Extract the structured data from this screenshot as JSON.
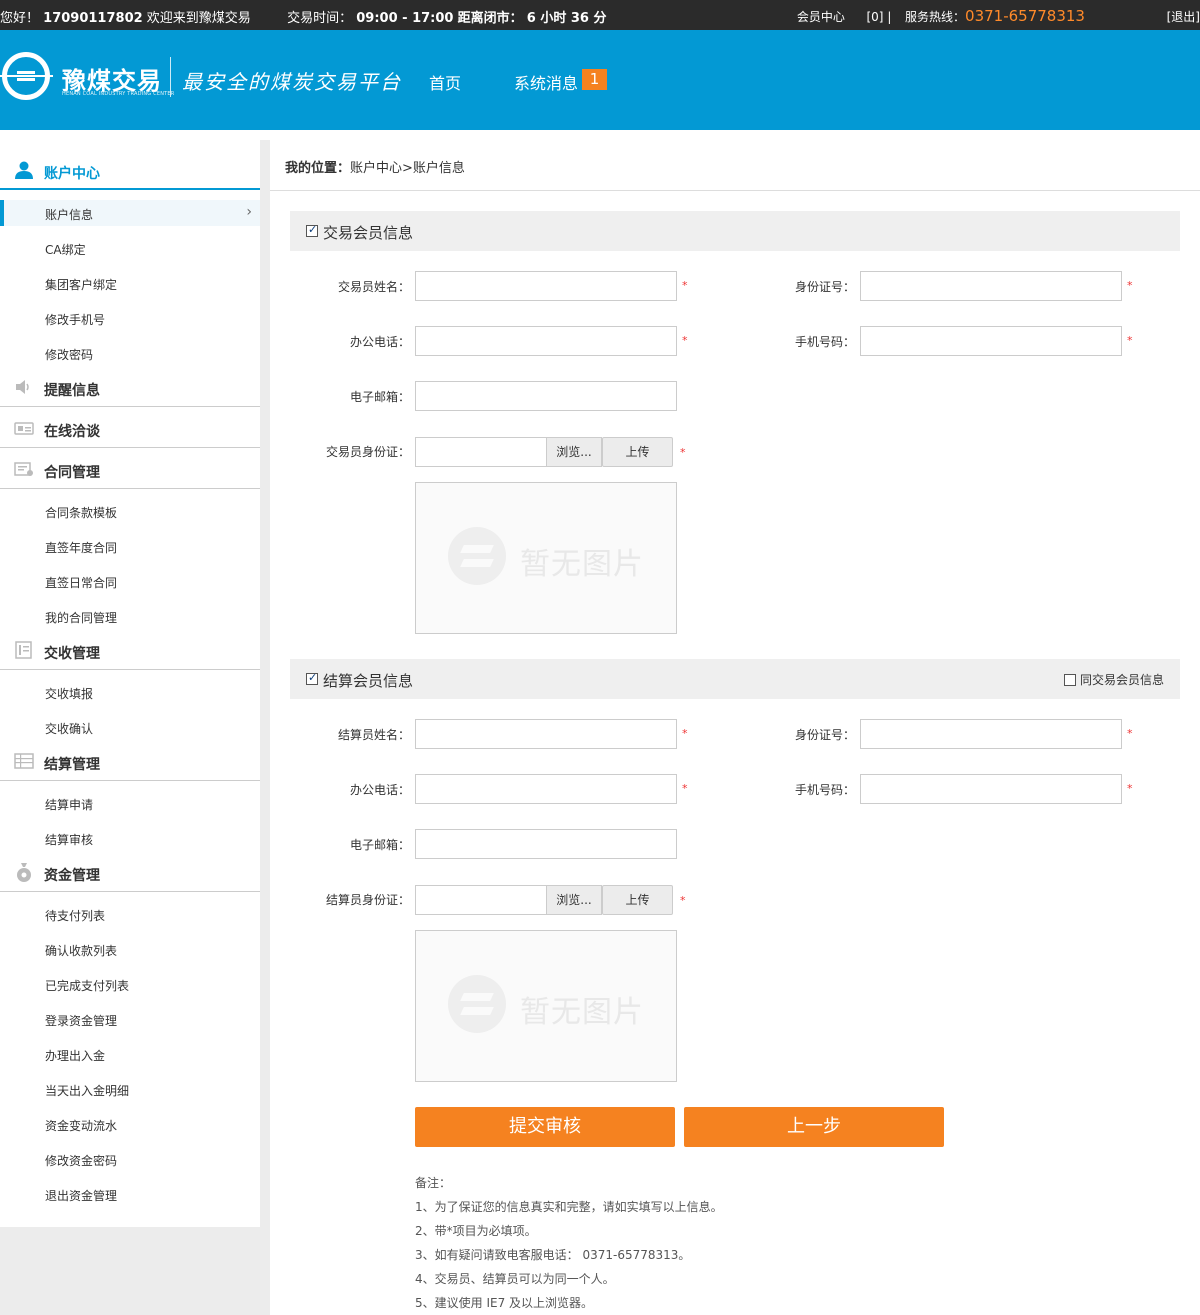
{
  "topbar": {
    "greeting": "您好！",
    "account": "17090117802",
    "welcome": "欢迎来到豫煤交易",
    "trade_time_label": "交易时间：",
    "trade_time": "09:00 - 17:00",
    "close_label": "距离闭市：",
    "close_remaining": "6 小时 36 分",
    "member_center": "会员中心",
    "member_count": "[0]",
    "separator": "|",
    "hotline_label": "服务热线：",
    "hotline": "0371-65778313",
    "logout": "[退出]"
  },
  "header": {
    "logo_text": "豫煤交易",
    "logo_sub": "HENAN COAL INDUSTRY TRADING CENTER",
    "slogan": "最安全的煤炭交易平台",
    "nav": {
      "home": "首页",
      "messages": "系统消息",
      "message_count": "1"
    }
  },
  "sidebar": {
    "account_center": "账户中心",
    "account_items": [
      "账户信息",
      "CA绑定",
      "集团客户绑定",
      "修改手机号",
      "修改密码"
    ],
    "reminders": "提醒信息",
    "negotiation": "在线洽谈",
    "contracts": "合同管理",
    "contract_items": [
      "合同条款模板",
      "直签年度合同",
      "直签日常合同",
      "我的合同管理"
    ],
    "delivery": "交收管理",
    "delivery_items": [
      "交收填报",
      "交收确认"
    ],
    "settlement": "结算管理",
    "settlement_items": [
      "结算申请",
      "结算审核"
    ],
    "funds": "资金管理",
    "fund_items": [
      "待支付列表",
      "确认收款列表",
      "已完成支付列表",
      "登录资金管理",
      "办理出入金",
      "当天出入金明细",
      "资金变动流水",
      "修改资金密码",
      "退出资金管理"
    ],
    "chevron": "›"
  },
  "breadcrumb": {
    "label": "我的位置：",
    "path": "账户中心>账户信息"
  },
  "trade_section": {
    "title": "交易会员信息",
    "checked": true,
    "name_label": "交易员姓名：",
    "id_label": "身份证号：",
    "office_phone_label": "办公电话：",
    "mobile_label": "手机号码：",
    "email_label": "电子邮箱：",
    "id_card_label": "交易员身份证：",
    "browse": "浏览...",
    "upload": "上传",
    "required_mark": "*",
    "no_image": "暂无图片"
  },
  "settle_section": {
    "title": "结算会员信息",
    "checked": true,
    "same_as_trade": "同交易会员信息",
    "same_checked": false,
    "name_label": "结算员姓名：",
    "id_label": "身份证号：",
    "office_phone_label": "办公电话：",
    "mobile_label": "手机号码：",
    "email_label": "电子邮箱：",
    "id_card_label": "结算员身份证：",
    "browse": "浏览...",
    "upload": "上传",
    "required_mark": "*",
    "no_image": "暂无图片"
  },
  "actions": {
    "submit": "提交审核",
    "back": "上一步"
  },
  "notes": {
    "title": "备注：",
    "items": [
      "1、为了保证您的信息真实和完整，请如实填写以上信息。",
      "2、带*项目为必填项。",
      "3、如有疑问请致电客服电话： 0371-65778313。",
      "4、交易员、结算员可以为同一个人。",
      "5、建议使用 IE7 及以上浏览器。"
    ]
  },
  "colors": {
    "brand_blue": "#0399d4",
    "accent_orange": "#f58220",
    "topbar": "#2b2b2b",
    "required_red": "#e33333"
  }
}
